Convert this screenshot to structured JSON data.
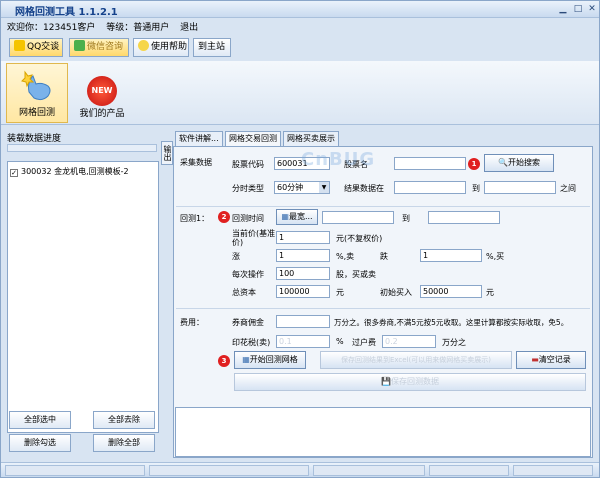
{
  "app": {
    "title": "网格回测工具 1.1.2.1"
  },
  "welcome": {
    "greeting": "欢迎你：",
    "user": "123451客户",
    "level_label": "等级：",
    "level": "普通用户",
    "logout": "退出"
  },
  "toolbar": {
    "qq": "QQ交谈",
    "wechat": "微信咨询",
    "help": "使用帮助",
    "home": "到主站"
  },
  "bigtabs": {
    "grid": "网格回测",
    "products": "我们的产品",
    "new_badge": "NEW"
  },
  "left": {
    "header": "装载数据进度",
    "items": [
      {
        "checked": "✓",
        "label": "300032 金龙机电,回测模板-2"
      }
    ],
    "select_all": "全部选中",
    "remove_all": "全部去除",
    "delete_checked": "删除勾选",
    "delete_all": "删除全部"
  },
  "side_tab": "输出",
  "tabs": [
    "软件讲解...",
    "网格交易回测",
    "网格买卖展示"
  ],
  "collect": {
    "title": "采集数据",
    "code_label": "股票代码",
    "code_value": "600031",
    "name_label": "股票名",
    "name_value": "",
    "search": "开始搜索",
    "period_label": "分时类型",
    "period_value": "60分钟",
    "result_label": "结果数据在",
    "to": "到",
    "between": "之间"
  },
  "backtest": {
    "title": "回测1：",
    "time_label": "回测时间",
    "latest": "最宽...",
    "to": "到",
    "price_label": "当前价(基准价)",
    "price_value": "1",
    "price_unit": "元(不复权价)",
    "rise_label": "涨",
    "rise_value": "1",
    "rise_unit": "%,卖",
    "fall_label": "跌",
    "fall_value": "1",
    "fall_unit": "%,买",
    "each_label": "每次操作",
    "each_value": "100",
    "each_unit": "股，买或卖",
    "capital_label": "总资本",
    "capital_value": "100000",
    "capital_unit": "元",
    "initial_label": "初始买入",
    "initial_value": "50000",
    "initial_unit": "元"
  },
  "fees": {
    "title": "费用：",
    "commission_label": "券商佣金",
    "commission_unit": "万分之。很多券商,不满5元按5元收取。这里计算都按实际收取，免5。",
    "stamp_label": "印花税(卖)",
    "stamp_value": "0.1",
    "stamp_unit": "%",
    "transfer_label": "过户费",
    "transfer_value": "0.2",
    "transfer_unit": "万分之"
  },
  "actions": {
    "start": "开始回测网格",
    "save_disabled": "保存回测结果到Excel(可以用来做网格买卖展示)",
    "clear": "清空记录",
    "save_data": "保存回测数据"
  },
  "badges": {
    "one": "1",
    "two": "2",
    "three": "3"
  },
  "watermark": "CnBUG"
}
